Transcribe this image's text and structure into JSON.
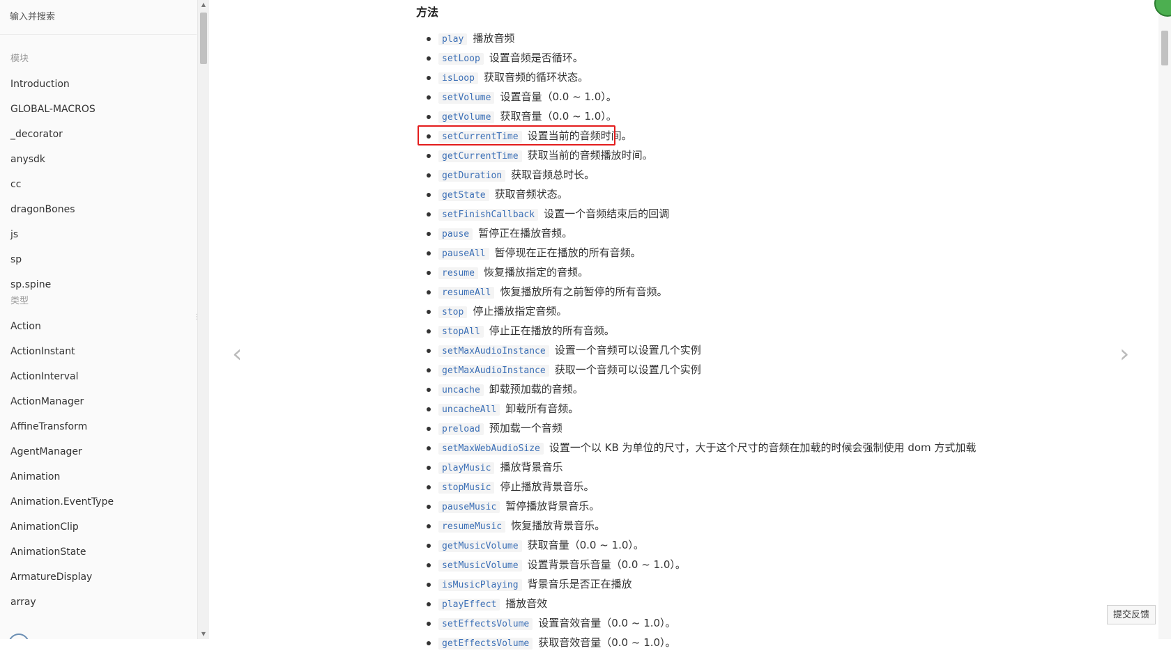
{
  "sidebar": {
    "search_placeholder": "输入并搜索",
    "modules_heading": "模块",
    "modules": [
      "Introduction",
      "GLOBAL-MACROS",
      "_decorator",
      "anysdk",
      "cc",
      "dragonBones",
      "js",
      "sp",
      "sp.spine"
    ],
    "types_heading": "类型",
    "types": [
      "Action",
      "ActionInstant",
      "ActionInterval",
      "ActionManager",
      "AffineTransform",
      "AgentManager",
      "Animation",
      "Animation.EventType",
      "AnimationClip",
      "AnimationState",
      "ArmatureDisplay",
      "array"
    ]
  },
  "content": {
    "section_title": "方法",
    "methods": [
      {
        "code": "play",
        "desc": "播放音频"
      },
      {
        "code": "setLoop",
        "desc": "设置音频是否循环。"
      },
      {
        "code": "isLoop",
        "desc": "获取音频的循环状态。"
      },
      {
        "code": "setVolume",
        "desc": "设置音量（0.0 ~ 1.0）。"
      },
      {
        "code": "getVolume",
        "desc": "获取音量（0.0 ~ 1.0）。"
      },
      {
        "code": "setCurrentTime",
        "desc": "设置当前的音频时间。"
      },
      {
        "code": "getCurrentTime",
        "desc": "获取当前的音频播放时间。"
      },
      {
        "code": "getDuration",
        "desc": "获取音频总时长。"
      },
      {
        "code": "getState",
        "desc": "获取音频状态。"
      },
      {
        "code": "setFinishCallback",
        "desc": "设置一个音频结束后的回调"
      },
      {
        "code": "pause",
        "desc": "暂停正在播放音频。"
      },
      {
        "code": "pauseAll",
        "desc": "暂停现在正在播放的所有音频。"
      },
      {
        "code": "resume",
        "desc": "恢复播放指定的音频。"
      },
      {
        "code": "resumeAll",
        "desc": "恢复播放所有之前暂停的所有音频。"
      },
      {
        "code": "stop",
        "desc": "停止播放指定音频。"
      },
      {
        "code": "stopAll",
        "desc": "停止正在播放的所有音频。"
      },
      {
        "code": "setMaxAudioInstance",
        "desc": "设置一个音频可以设置几个实例"
      },
      {
        "code": "getMaxAudioInstance",
        "desc": "获取一个音频可以设置几个实例"
      },
      {
        "code": "uncache",
        "desc": "卸载预加载的音频。"
      },
      {
        "code": "uncacheAll",
        "desc": "卸载所有音频。"
      },
      {
        "code": "preload",
        "desc": "预加载一个音频"
      },
      {
        "code": "setMaxWebAudioSize",
        "desc": "设置一个以 KB 为单位的尺寸，大于这个尺寸的音频在加载的时候会强制使用 dom 方式加载"
      },
      {
        "code": "playMusic",
        "desc": "播放背景音乐"
      },
      {
        "code": "stopMusic",
        "desc": "停止播放背景音乐。"
      },
      {
        "code": "pauseMusic",
        "desc": "暂停播放背景音乐。"
      },
      {
        "code": "resumeMusic",
        "desc": "恢复播放背景音乐。"
      },
      {
        "code": "getMusicVolume",
        "desc": "获取音量（0.0 ~ 1.0）。"
      },
      {
        "code": "setMusicVolume",
        "desc": "设置背景音乐音量（0.0 ~ 1.0）。"
      },
      {
        "code": "isMusicPlaying",
        "desc": "背景音乐是否正在播放"
      },
      {
        "code": "playEffect",
        "desc": "播放音效"
      },
      {
        "code": "setEffectsVolume",
        "desc": "设置音效音量（0.0 ~ 1.0）。"
      },
      {
        "code": "getEffectsVolume",
        "desc": "获取音效音量（0.0 ~ 1.0）。"
      }
    ],
    "highlighted_method": "setCurrentTime"
  },
  "feedback_label": "提交反馈",
  "colors": {
    "code_text": "#3b6fb6",
    "highlight": "#e31c1c"
  },
  "icons": {
    "prev": "chevron-left-icon",
    "next": "chevron-right-icon"
  }
}
